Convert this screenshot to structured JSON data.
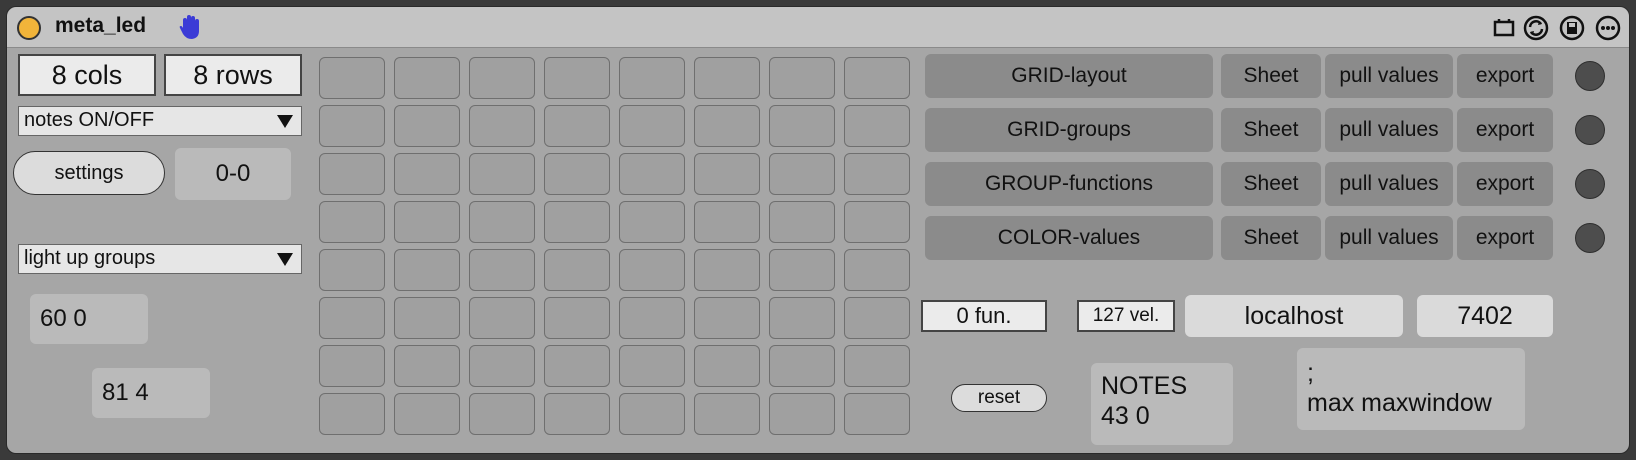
{
  "device": {
    "title": "meta_led",
    "titlebar_icons": [
      "map-icon",
      "refresh-icon",
      "save-icon",
      "more-icon"
    ]
  },
  "left": {
    "cols": "8 cols",
    "rows": "8 rows",
    "mode_menu": "notes ON/OFF",
    "settings_label": "settings",
    "coord": "0-0",
    "light_menu": "light up groups",
    "msg1": "60 0",
    "msg2": "81 4"
  },
  "grid": {
    "cols": 8,
    "rows": 8
  },
  "sheets": [
    {
      "name": "GRID-layout",
      "sheet": "Sheet",
      "pull": "pull values",
      "export": "export"
    },
    {
      "name": "GRID-groups",
      "sheet": "Sheet",
      "pull": "pull values",
      "export": "export"
    },
    {
      "name": "GROUP-functions",
      "sheet": "Sheet",
      "pull": "pull values",
      "export": "export"
    },
    {
      "name": "COLOR-values",
      "sheet": "Sheet",
      "pull": "pull values",
      "export": "export"
    }
  ],
  "bottom": {
    "fun": "0 fun.",
    "vel": "127 vel.",
    "host": "localhost",
    "port": "7402",
    "reset_label": "reset",
    "notes_line1": "NOTES",
    "notes_line2": "43 0",
    "max_line1": ";",
    "max_line2": "max maxwindow"
  },
  "colors": {
    "accent_power": "#f1b43a",
    "hand": "#3b3bd6",
    "device_bg": "#a6a6a6"
  }
}
